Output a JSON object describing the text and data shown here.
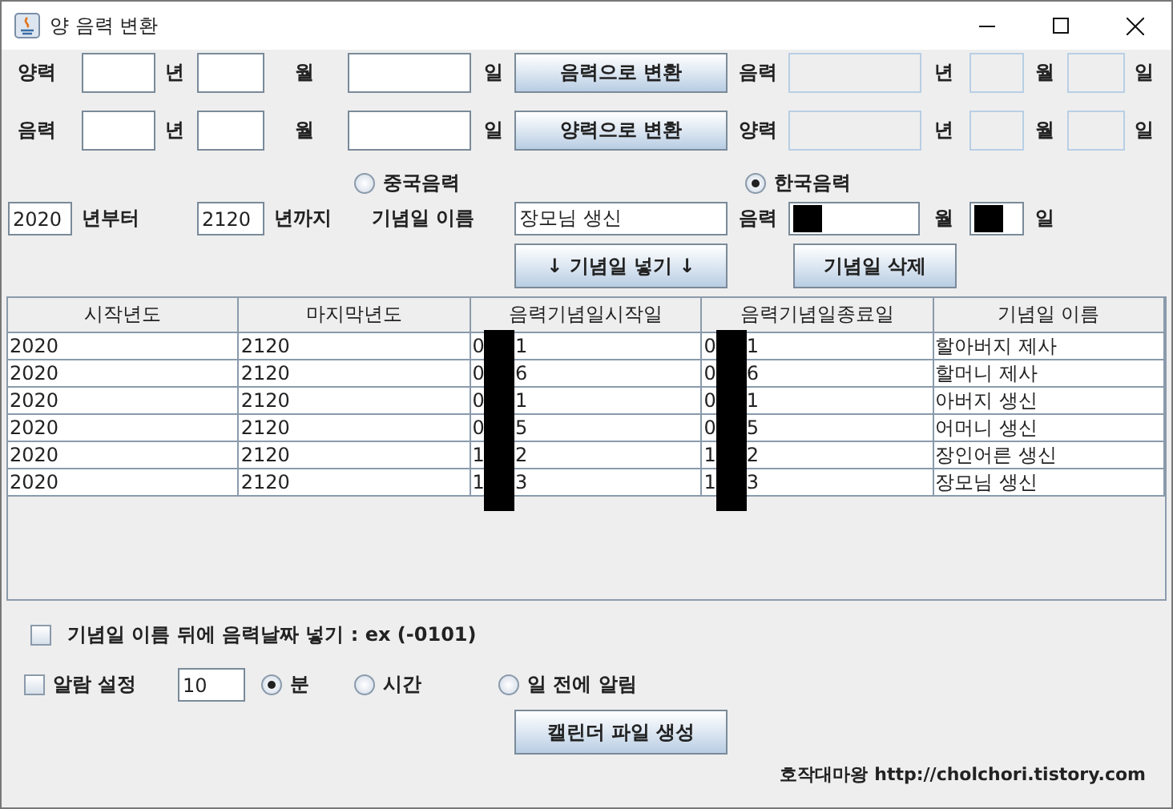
{
  "window": {
    "title": "양 음력 변환"
  },
  "converters": [
    {
      "label": "양력",
      "year_unit": "년",
      "month_unit": "월",
      "day_unit": "일",
      "button": "음력으로 변환",
      "result_label": "음력",
      "result_year_unit": "년",
      "result_month_unit": "월",
      "result_day_unit": "일"
    },
    {
      "label": "음력",
      "year_unit": "년",
      "month_unit": "월",
      "day_unit": "일",
      "button": "양력으로 변환",
      "result_label": "양력",
      "result_year_unit": "년",
      "result_month_unit": "월",
      "result_day_unit": "일"
    }
  ],
  "calendar_options": [
    {
      "label": "중국음력",
      "selected": false
    },
    {
      "label": "한국음력",
      "selected": true
    }
  ],
  "range": {
    "start_year": "2020",
    "start_label": "년부터",
    "end_year": "2120",
    "end_label": "년까지",
    "name_label": "기념일 이름",
    "name_value": "장모님 생신",
    "lunar_label": "음력",
    "month_redacted": true,
    "month_unit": "월",
    "day_redacted": true,
    "day_unit": "일"
  },
  "add_button": "↓ 기념일 넣기 ↓",
  "delete_button": "기념일 삭제",
  "table": {
    "columns": [
      "시작년도",
      "마지막년도",
      "음력기념일시작일",
      "음력기념일종료일",
      "기념일 이름"
    ],
    "rows": [
      [
        "2020",
        "2120",
        {
          "lead": "0",
          "tail": "1"
        },
        {
          "lead": "0",
          "tail": "1"
        },
        "할아버지 제사"
      ],
      [
        "2020",
        "2120",
        {
          "lead": "0",
          "tail": "6"
        },
        {
          "lead": "0",
          "tail": "6"
        },
        "할머니 제사"
      ],
      [
        "2020",
        "2120",
        {
          "lead": "0",
          "tail": "1"
        },
        {
          "lead": "0",
          "tail": "1"
        },
        "아버지 생신"
      ],
      [
        "2020",
        "2120",
        {
          "lead": "0",
          "tail": "5"
        },
        {
          "lead": "0",
          "tail": "5"
        },
        "어머니 생신"
      ],
      [
        "2020",
        "2120",
        {
          "lead": "1",
          "tail": "2"
        },
        {
          "lead": "1",
          "tail": "2"
        },
        "장인어른 생신"
      ],
      [
        "2020",
        "2120",
        {
          "lead": "1",
          "tail": "3"
        },
        {
          "lead": "1",
          "tail": "3"
        },
        "장모님 생신"
      ]
    ]
  },
  "append_option": {
    "label": "기념일 이름 뒤에 음력날짜 넣기 : ex (-0101)",
    "checked": false
  },
  "alarm": {
    "label": "알람 설정",
    "checked": false,
    "value": "10",
    "units": [
      {
        "label": "분",
        "selected": true
      },
      {
        "label": "시간",
        "selected": false
      },
      {
        "label": "일 전에 알림",
        "selected": false
      }
    ]
  },
  "create_button": "캘린더 파일 생성",
  "footer": {
    "author": "호작대마왕",
    "url": "http://cholchori.tistory.com"
  }
}
